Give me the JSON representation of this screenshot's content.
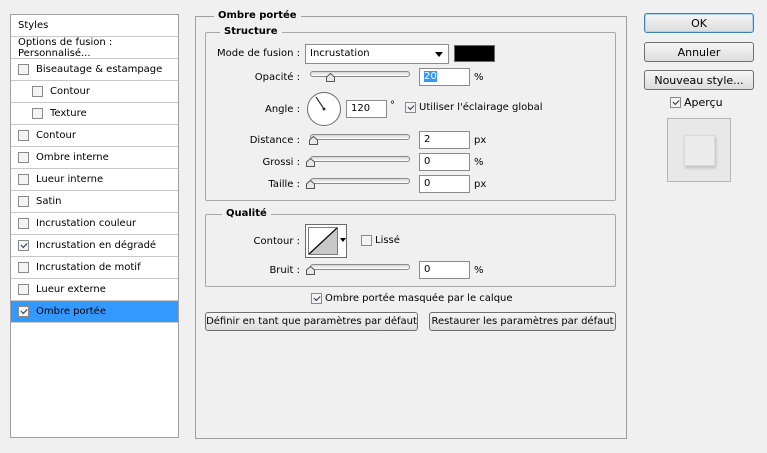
{
  "sidebar": {
    "header": "Styles",
    "blending_options": "Options de fusion : Personnalisé...",
    "items": [
      {
        "label": "Biseautage & estampage",
        "checked": false
      },
      {
        "label": "Contour",
        "checked": false
      },
      {
        "label": "Texture",
        "checked": false
      },
      {
        "label": "Contour",
        "checked": false
      },
      {
        "label": "Ombre interne",
        "checked": false
      },
      {
        "label": "Lueur interne",
        "checked": false
      },
      {
        "label": "Satin",
        "checked": false
      },
      {
        "label": "Incrustation couleur",
        "checked": false
      },
      {
        "label": "Incrustation en dégradé",
        "checked": true
      },
      {
        "label": "Incrustation de motif",
        "checked": false
      },
      {
        "label": "Lueur externe",
        "checked": false
      },
      {
        "label": "Ombre portée",
        "checked": true,
        "selected": true
      }
    ]
  },
  "panel": {
    "title": "Ombre portée",
    "structure": {
      "title": "Structure",
      "blend_mode_label": "Mode de fusion :",
      "blend_mode_value": "Incrustation",
      "shadow_color": "#000000",
      "opacity_label": "Opacité :",
      "opacity_value": "20",
      "opacity_unit": "%",
      "opacity_fraction": 0.2,
      "angle_label": "Angle :",
      "angle_value": "120",
      "angle_unit": "°",
      "global_light_label": "Utiliser l'éclairage global",
      "global_light_checked": true,
      "distance_label": "Distance :",
      "distance_value": "2",
      "distance_unit": "px",
      "spread_label": "Grossi :",
      "spread_value": "0",
      "spread_unit": "%",
      "size_label": "Taille :",
      "size_value": "0",
      "size_unit": "px"
    },
    "quality": {
      "title": "Qualité",
      "contour_label": "Contour :",
      "antialias_label": "Lissé",
      "antialias_checked": false,
      "noise_label": "Bruit :",
      "noise_value": "0",
      "noise_unit": "%"
    },
    "knockout_label": "Ombre portée masquée par le calque",
    "knockout_checked": true,
    "make_default_label": "Définir en tant que paramètres par défaut",
    "reset_default_label": "Restaurer les paramètres par défaut"
  },
  "actions": {
    "ok_label": "OK",
    "cancel_label": "Annuler",
    "new_style_label": "Nouveau style...",
    "preview_label": "Aperçu",
    "preview_checked": true
  },
  "colors": {
    "selection": "#3399ff",
    "background": "#f0f0f0"
  }
}
